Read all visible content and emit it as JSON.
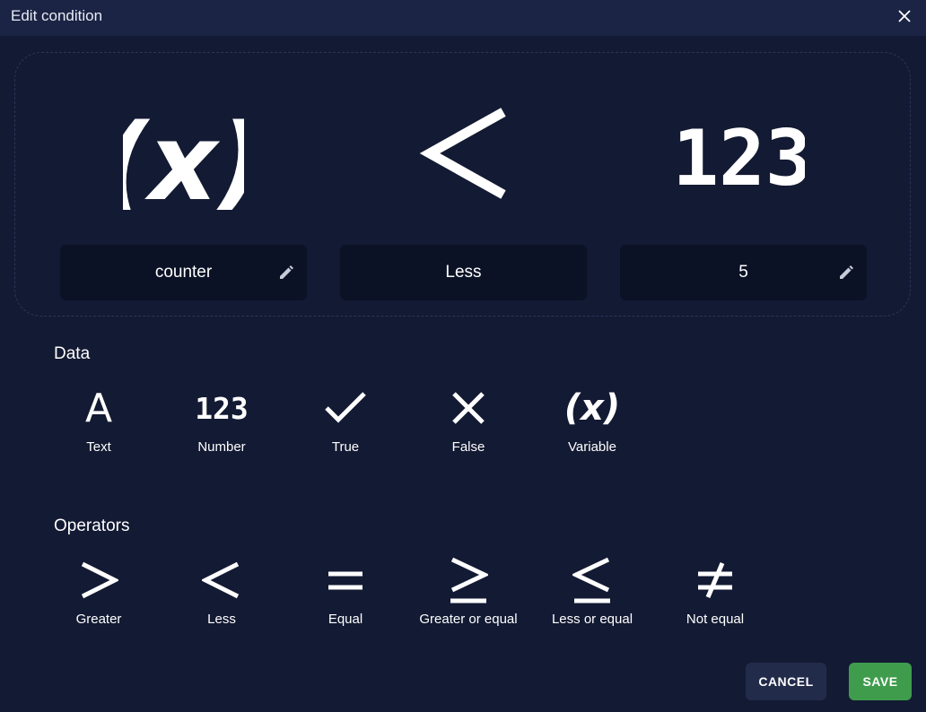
{
  "dialog": {
    "title": "Edit condition",
    "close_icon": "close-icon"
  },
  "preview": {
    "left_symbol": "(x)",
    "operator_symbol": "<",
    "right_symbol": "123",
    "left_value": "counter",
    "operator_value": "Less",
    "right_value": "5"
  },
  "data_section": {
    "title": "Data",
    "items": [
      {
        "label": "Text",
        "glyph": "A",
        "icon": "text-icon"
      },
      {
        "label": "Number",
        "glyph": "123",
        "icon": "number-icon"
      },
      {
        "label": "True",
        "icon": "check-icon"
      },
      {
        "label": "False",
        "icon": "cross-icon"
      },
      {
        "label": "Variable",
        "glyph": "(x)",
        "icon": "variable-icon"
      }
    ]
  },
  "operators_section": {
    "title": "Operators",
    "items": [
      {
        "label": "Greater",
        "icon": "greater-icon"
      },
      {
        "label": "Less",
        "icon": "less-icon"
      },
      {
        "label": "Equal",
        "icon": "equal-icon"
      },
      {
        "label": "Greater or equal",
        "icon": "greater-or-equal-icon"
      },
      {
        "label": "Less or equal",
        "icon": "less-or-equal-icon"
      },
      {
        "label": "Not equal",
        "icon": "not-equal-icon"
      }
    ]
  },
  "actions": {
    "cancel_label": "CANCEL",
    "save_label": "SAVE"
  },
  "colors": {
    "background": "#131a33",
    "titlebar": "#1b2445",
    "field": "#0b1226",
    "save": "#3f9c4d",
    "cancel": "#222b4a"
  }
}
